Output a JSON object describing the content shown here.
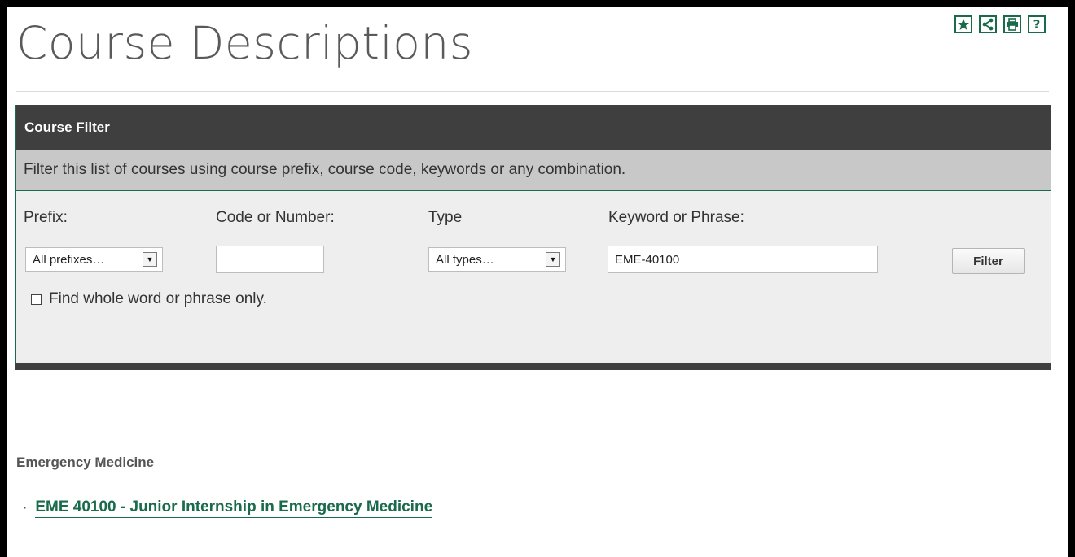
{
  "page": {
    "title": "Course Descriptions"
  },
  "toolbar": {
    "favorite": {
      "icon": "star-icon"
    },
    "share": {
      "icon": "share-icon"
    },
    "print": {
      "icon": "printer-icon"
    },
    "help": {
      "icon": "help-icon",
      "glyph": "?"
    }
  },
  "filter": {
    "header": "Course Filter",
    "description": "Filter this list of courses using course prefix, course code, keywords or any combination.",
    "prefix": {
      "label": "Prefix:",
      "selected": "All prefixes…"
    },
    "code": {
      "label": "Code or Number:",
      "value": "",
      "placeholder": ""
    },
    "type": {
      "label": "Type",
      "selected": "All types…"
    },
    "keyword": {
      "label": "Keyword or Phrase:",
      "value": "EME-40100"
    },
    "submit_label": "Filter",
    "whole_word": {
      "label": "Find whole word or phrase only.",
      "checked": false
    }
  },
  "results": {
    "heading": "Emergency Medicine",
    "items": [
      {
        "bullet": "·",
        "label": "EME 40100  - Junior Internship in Emergency Medicine"
      }
    ]
  },
  "colors": {
    "accent": "#1a6b4b",
    "header_bg": "#3f3f3f",
    "description_bg": "#c8c8c8",
    "filter_bg": "#eeeeee",
    "title_text": "#5a5a5a"
  }
}
